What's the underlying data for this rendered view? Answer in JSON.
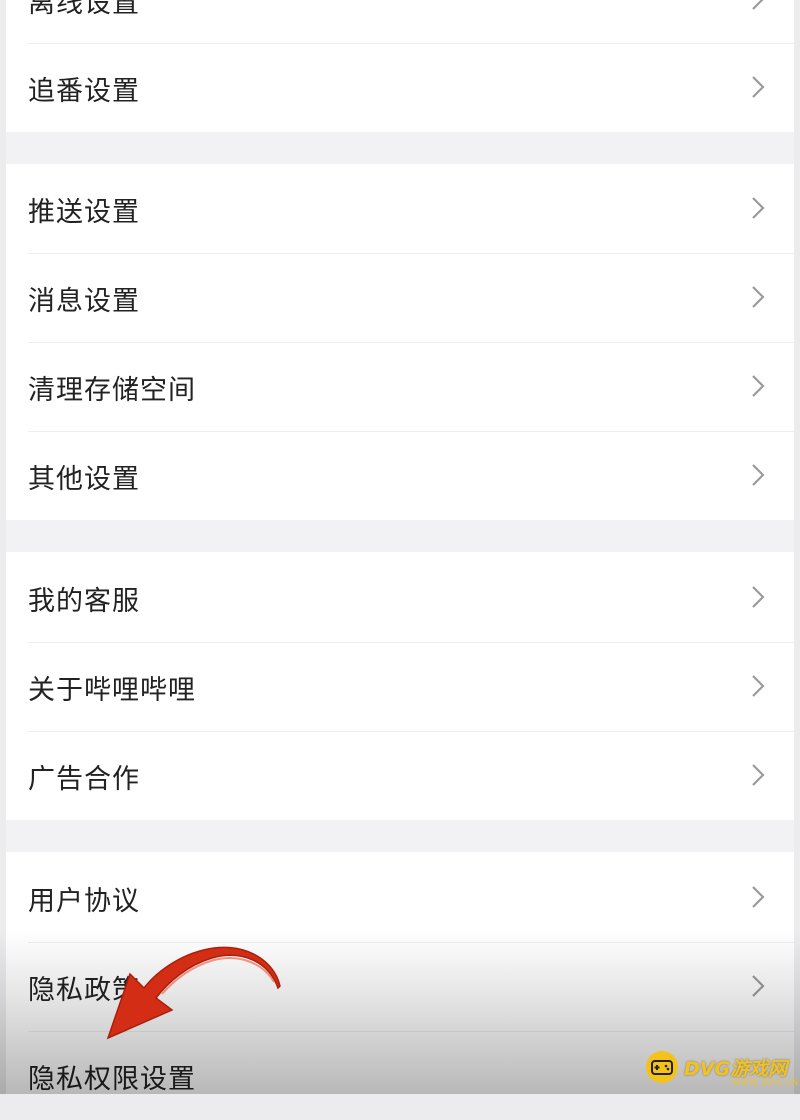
{
  "settings": {
    "group1": [
      {
        "label": "离线设置"
      },
      {
        "label": "追番设置"
      }
    ],
    "group2": [
      {
        "label": "推送设置"
      },
      {
        "label": "消息设置"
      },
      {
        "label": "清理存储空间"
      },
      {
        "label": "其他设置"
      }
    ],
    "group3": [
      {
        "label": "我的客服"
      },
      {
        "label": "关于哔哩哔哩"
      },
      {
        "label": "广告合作"
      }
    ],
    "group4": [
      {
        "label": "用户协议"
      },
      {
        "label": "隐私政策"
      },
      {
        "label": "隐私权限设置"
      }
    ]
  },
  "icons": {
    "row_chevron": "chevron-right-icon",
    "annotation": "red-curved-arrow-icon"
  },
  "colors": {
    "annotation_arrow": "#d42d16",
    "watermark": "#f5c21a"
  },
  "watermark": {
    "text": "DVG游戏网",
    "sub": "WWW.DVG.CN"
  }
}
